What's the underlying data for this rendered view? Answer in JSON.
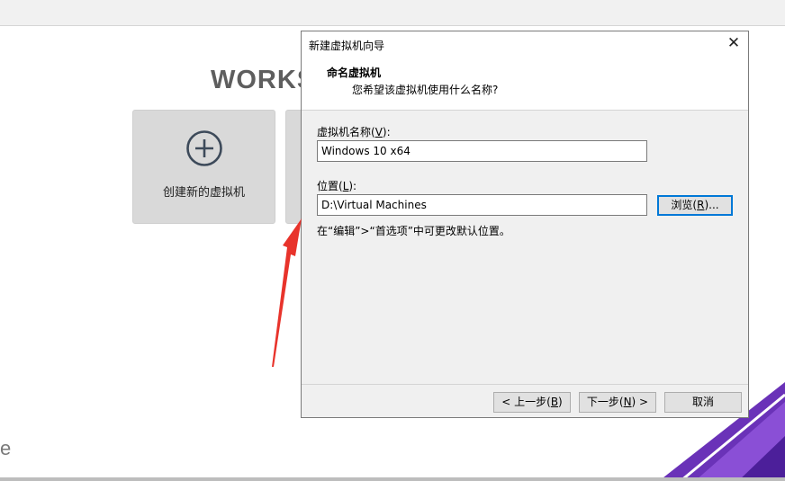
{
  "background": {
    "brand_text": "WORKS",
    "card_create_label": "创建新的虚拟机",
    "corner_text": "e"
  },
  "dialog": {
    "title": "新建虚拟机向导",
    "heading": "命名虚拟机",
    "subheading": "您希望该虚拟机使用什么名称?",
    "vm_name_label": "虚拟机名称(",
    "vm_name_key": "V",
    "vm_name_label_end": "):",
    "vm_name_value": "Windows 10 x64",
    "location_label": "位置(",
    "location_key": "L",
    "location_label_end": "):",
    "location_value": "D:\\Virtual Machines",
    "browse_label": "浏览(",
    "browse_key": "R",
    "browse_label_end": ")...",
    "hint": "在“编辑”>“首选项”中可更改默认位置。",
    "back_label": "< 上一步(",
    "back_key": "B",
    "back_label_end": ")",
    "next_label": "下一步(",
    "next_key": "N",
    "next_label_end": ") >",
    "cancel_label": "取消"
  },
  "colors": {
    "arrow": "#e8332b",
    "accent_purple": "#6a32b8",
    "focus_blue": "#0078d7"
  }
}
